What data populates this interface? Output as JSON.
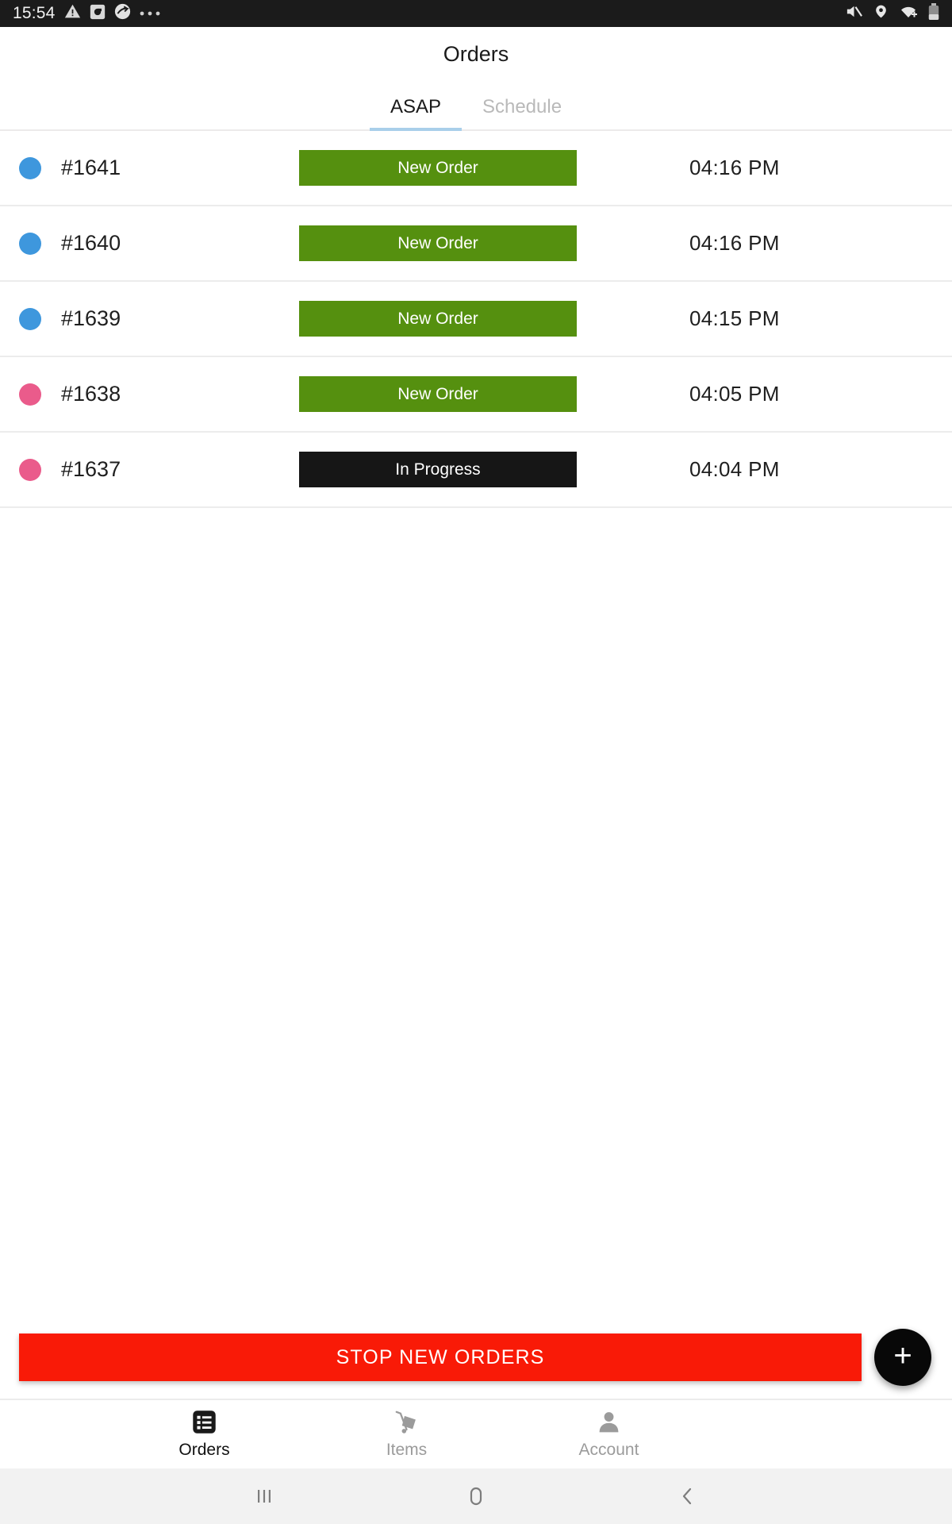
{
  "status_bar": {
    "clock": "15:54",
    "left_icons": [
      "warning-triangle-icon",
      "app-square-icon",
      "app-swoosh-icon",
      "overflow-dots-icon"
    ],
    "right_icons": [
      "volume-mute-icon",
      "location-pin-icon",
      "wifi-icon",
      "battery-icon"
    ],
    "background": "#1b1b1b"
  },
  "app_bar": {
    "title": "Orders"
  },
  "tabs": {
    "items": [
      {
        "label": "ASAP",
        "active": true
      },
      {
        "label": "Schedule",
        "active": false
      }
    ],
    "indicator_color": "#a9cfea"
  },
  "orders": {
    "columns": [
      "marker",
      "order_id",
      "status",
      "time"
    ],
    "rows": [
      {
        "dot_color": "#3e97dd",
        "order_id": "#1641",
        "status": "New Order",
        "status_type": "new",
        "time": "04:16 PM"
      },
      {
        "dot_color": "#3e97dd",
        "order_id": "#1640",
        "status": "New Order",
        "status_type": "new",
        "time": "04:16 PM"
      },
      {
        "dot_color": "#3e97dd",
        "order_id": "#1639",
        "status": "New Order",
        "status_type": "new",
        "time": "04:15 PM"
      },
      {
        "dot_color": "#ea5b8b",
        "order_id": "#1638",
        "status": "New Order",
        "status_type": "new",
        "time": "04:05 PM"
      },
      {
        "dot_color": "#ea5b8b",
        "order_id": "#1637",
        "status": "In Progress",
        "status_type": "progress",
        "time": "04:04 PM"
      }
    ]
  },
  "actions": {
    "stop_new_orders_label": "STOP NEW ORDERS",
    "stop_color": "#f91a07",
    "fab_label": "+",
    "fab_icon": "plus-icon",
    "fab_color": "#080808"
  },
  "bottom_nav": {
    "items": [
      {
        "label": "Orders",
        "icon": "list-icon",
        "active": true
      },
      {
        "label": "Items",
        "icon": "trolley-icon",
        "active": false
      },
      {
        "label": "Account",
        "icon": "person-icon",
        "active": false
      }
    ]
  },
  "android_nav": {
    "buttons": [
      "recents-icon",
      "home-icon",
      "back-icon"
    ]
  },
  "colors": {
    "new_order_green": "#55900f",
    "in_progress_black": "#161616",
    "divider": "#ececec"
  }
}
